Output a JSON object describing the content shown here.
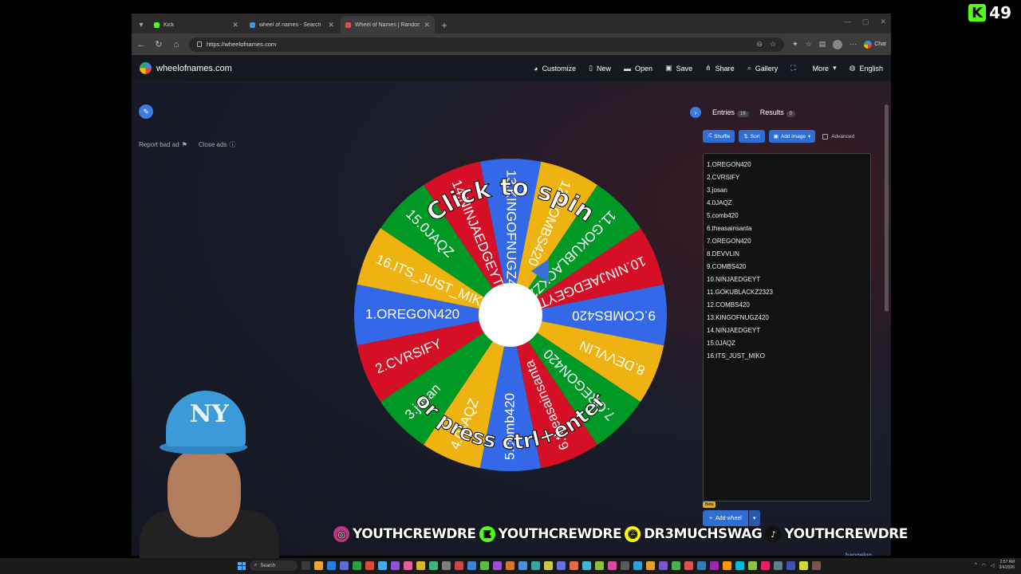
{
  "kick_badge": {
    "letter": "K",
    "count": "49"
  },
  "browser": {
    "tabs": [
      {
        "title": "Kick",
        "color": "#53fc18"
      },
      {
        "title": "wheel of names - Search",
        "color": "#4a90e2"
      },
      {
        "title": "Wheel of Names | Random name",
        "color": "#e94b4b"
      }
    ],
    "url": "https://wheelofnames.com",
    "chat_label": "Chat"
  },
  "site": {
    "logo_text": "wheelofnames.com",
    "menu": [
      {
        "label": "Customize",
        "icon": "palette-icon",
        "glyph": "◕"
      },
      {
        "label": "New",
        "icon": "new-file-icon",
        "glyph": "▯"
      },
      {
        "label": "Open",
        "icon": "folder-icon",
        "glyph": "▬"
      },
      {
        "label": "Save",
        "icon": "save-icon",
        "glyph": "▣"
      },
      {
        "label": "Share",
        "icon": "share-icon",
        "glyph": "⋔"
      },
      {
        "label": "Gallery",
        "icon": "search-icon",
        "glyph": "⌕"
      },
      {
        "label": "",
        "icon": "fullscreen-icon",
        "glyph": "⛶"
      },
      {
        "label": "More",
        "icon": "more-icon",
        "glyph": "▾"
      },
      {
        "label": "English",
        "icon": "globe-icon",
        "glyph": "◍"
      }
    ],
    "report_ad": "Report bad ad",
    "close_ads": "Close ads"
  },
  "wheel": {
    "segments": [
      "1.OREGON420",
      "2.CVRSIFY",
      "3.josan",
      "4.0JAQZ",
      "5.comb420",
      "6.theasainsanta",
      "7.OREGON420",
      "8.DEVVLIN",
      "9.COMBS420",
      "10.NINJAEDGEYT",
      "11.GOKUBLACKZ2323",
      "12.COMBS420",
      "13.KINGOFNUGZ420",
      "14.NINJAEDGEYT",
      "15.0JAQZ",
      "16.ITS_JUST_MIKO"
    ],
    "colors": [
      "#3369e8",
      "#d50f25",
      "#eeb211",
      "#009925"
    ],
    "spin_text_top": "Click to spin",
    "spin_text_bottom": "or press ctrl+enter"
  },
  "panel": {
    "entries_tab": "Entries",
    "entries_count": "16",
    "results_tab": "Results",
    "results_count": "0",
    "shuffle_label": "Shuffle",
    "sort_label": "Sort",
    "add_image_label": "Add image",
    "advanced_label": "Advanced",
    "entries": [
      "1.OREGON420",
      "2.CVRSIFY",
      "3.josan",
      "4.0JAQZ",
      "5.comb420",
      "6.theasainsanta",
      "7.OREGON420",
      "8.DEVVLIN",
      "9.COMBS420",
      "10.NINJAEDGEYT",
      "11.GOKUBLACKZ2323",
      "12.COMBS420",
      "13.KINGOFNUGZ420",
      "14.NINJAEDGEYT",
      "15.0JAQZ",
      "16.ITS_JUST_MIKO"
    ],
    "beta_label": "Beta",
    "add_wheel_label": "Add wheel",
    "changelog_label": "hangelog"
  },
  "social": [
    {
      "handle": "YOUTHCREWDRE",
      "icon": "instagram-icon",
      "color": "#c13584",
      "glyph": "◎"
    },
    {
      "handle": "YOUTHCREWDRE",
      "icon": "kick-icon",
      "color": "#53fc18",
      "glyph": "K"
    },
    {
      "handle": "DR3MUCHSWAG",
      "icon": "snapchat-icon",
      "color": "#fffc00",
      "glyph": "☺"
    },
    {
      "handle": "YOUTHCREWDRE",
      "icon": "tiktok-icon",
      "color": "#111111",
      "glyph": "♪"
    }
  ],
  "taskbar": {
    "search_label": "Search",
    "time": "2:57 AM",
    "date": "3/4/2026"
  }
}
